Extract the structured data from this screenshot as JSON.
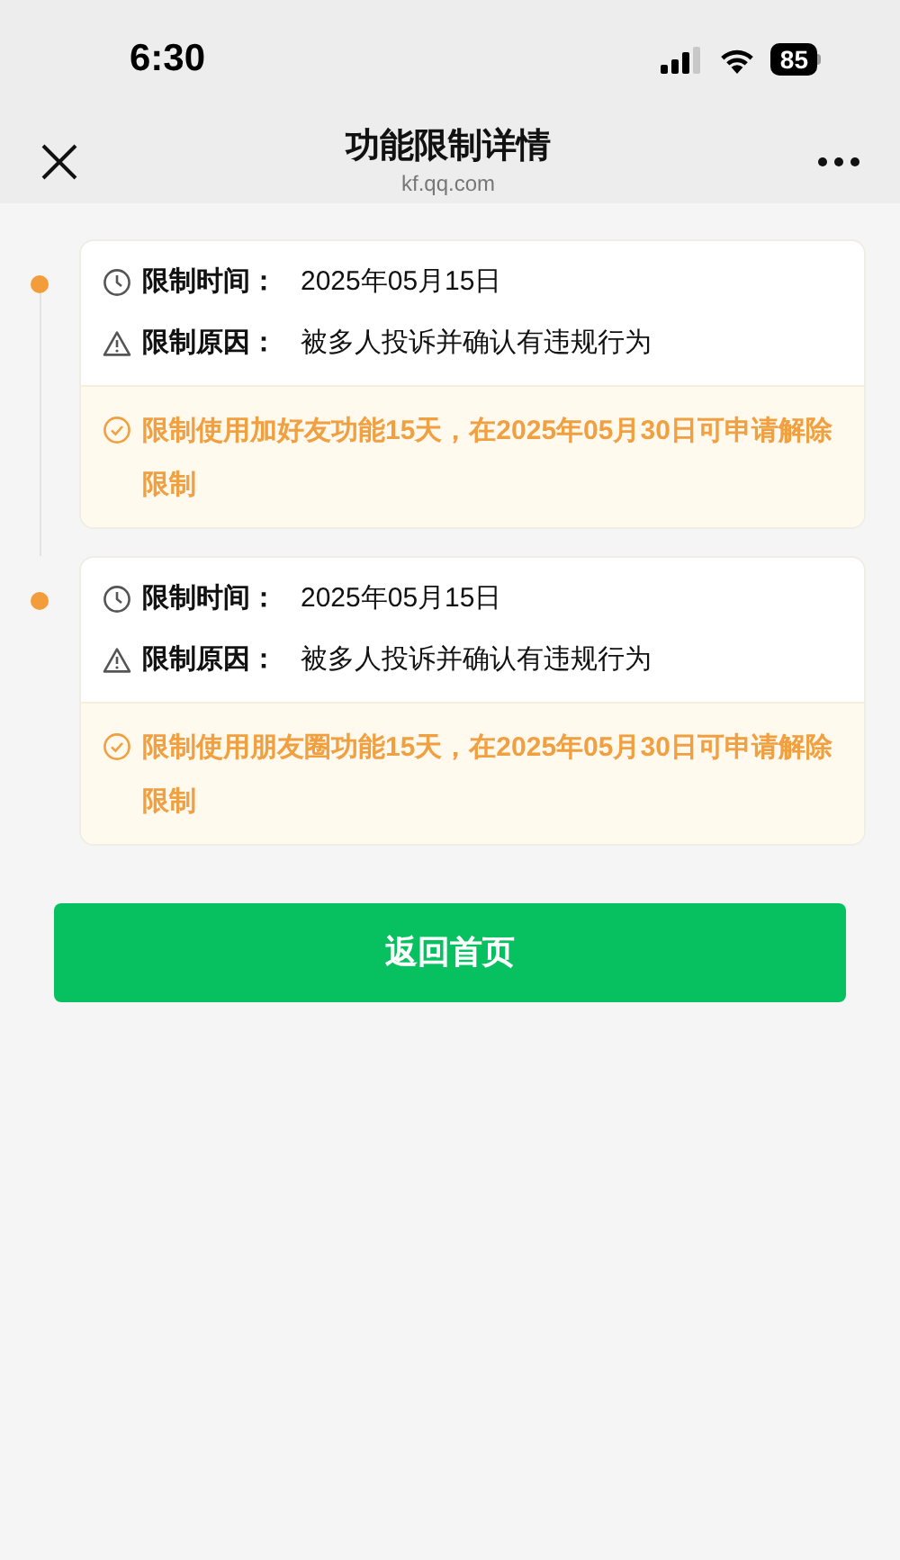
{
  "status_bar": {
    "time": "6:30",
    "battery": "85"
  },
  "nav_bar": {
    "title": "功能限制详情",
    "subtitle": "kf.qq.com"
  },
  "restrictions": [
    {
      "time_label": "限制时间：",
      "time_value": "2025年05月15日",
      "reason_label": "限制原因：",
      "reason_value": "被多人投诉并确认有违规行为",
      "notice": "限制使用加好友功能15天，在2025年05月30日可申请解除限制"
    },
    {
      "time_label": "限制时间：",
      "time_value": "2025年05月15日",
      "reason_label": "限制原因：",
      "reason_value": "被多人投诉并确认有违规行为",
      "notice": "限制使用朋友圈功能15天，在2025年05月30日可申请解除限制"
    }
  ],
  "button": "返回首页"
}
